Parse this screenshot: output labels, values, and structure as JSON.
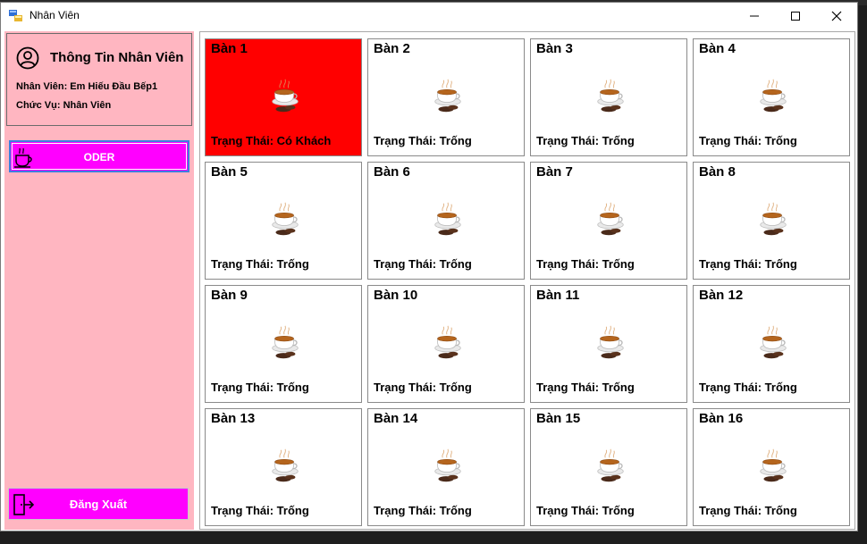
{
  "window": {
    "title": "Nhân Viên"
  },
  "sidebar": {
    "info": {
      "title": "Thông Tin Nhân Viên",
      "employee": "Nhân Viên: Em Hiếu Đầu Bếp1",
      "position": "Chức Vụ: Nhân Viên"
    },
    "oder_label": "ODER",
    "logout_label": "Đăng Xuất"
  },
  "colors": {
    "sidebar_bg": "#ffb6c1",
    "button_bg": "#ff00ff",
    "busy_table": "#ff0000",
    "free_table": "#ffffff"
  },
  "tables": [
    {
      "name": "Bàn 1",
      "status": "Trạng Thái: Có Khách",
      "busy": true
    },
    {
      "name": "Bàn 2",
      "status": "Trạng Thái: Trống",
      "busy": false
    },
    {
      "name": "Bàn 3",
      "status": "Trạng Thái: Trống",
      "busy": false
    },
    {
      "name": "Bàn 4",
      "status": "Trạng Thái: Trống",
      "busy": false
    },
    {
      "name": "Bàn 5",
      "status": "Trạng Thái: Trống",
      "busy": false
    },
    {
      "name": "Bàn 6",
      "status": "Trạng Thái: Trống",
      "busy": false
    },
    {
      "name": "Bàn 7",
      "status": "Trạng Thái: Trống",
      "busy": false
    },
    {
      "name": "Bàn 8",
      "status": "Trạng Thái: Trống",
      "busy": false
    },
    {
      "name": "Bàn 9",
      "status": "Trạng Thái: Trống",
      "busy": false
    },
    {
      "name": "Bàn 10",
      "status": "Trạng Thái: Trống",
      "busy": false
    },
    {
      "name": "Bàn 11",
      "status": "Trạng Thái: Trống",
      "busy": false
    },
    {
      "name": "Bàn 12",
      "status": "Trạng Thái: Trống",
      "busy": false
    },
    {
      "name": "Bàn 13",
      "status": "Trạng Thái: Trống",
      "busy": false
    },
    {
      "name": "Bàn 14",
      "status": "Trạng Thái: Trống",
      "busy": false
    },
    {
      "name": "Bàn 15",
      "status": "Trạng Thái: Trống",
      "busy": false
    },
    {
      "name": "Bàn 16",
      "status": "Trạng Thái: Trống",
      "busy": false
    }
  ]
}
